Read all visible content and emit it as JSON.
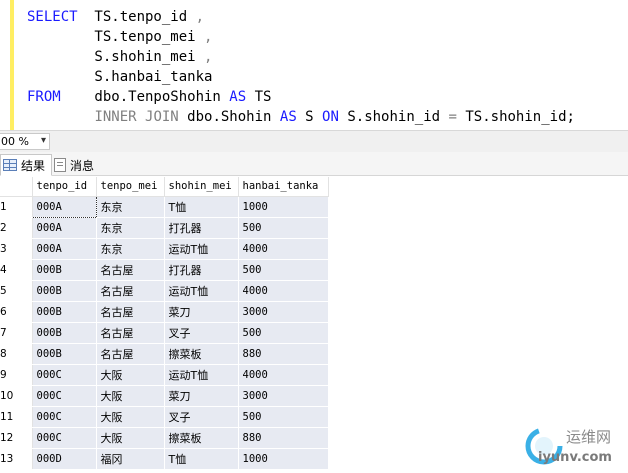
{
  "sql": {
    "lines": [
      [
        {
          "t": "SELECT",
          "c": "kw"
        },
        {
          "t": "  TS.tenpo_id ",
          "c": ""
        },
        {
          "t": ",",
          "c": "op"
        }
      ],
      [
        {
          "t": "        TS.tenpo_mei ",
          "c": ""
        },
        {
          "t": ",",
          "c": "op"
        }
      ],
      [
        {
          "t": "        S.shohin_mei ",
          "c": ""
        },
        {
          "t": ",",
          "c": "op"
        }
      ],
      [
        {
          "t": "        S.hanbai_tanka",
          "c": ""
        }
      ],
      [
        {
          "t": "FROM",
          "c": "kw"
        },
        {
          "t": "    dbo.TenpoShohin ",
          "c": ""
        },
        {
          "t": "AS",
          "c": "kw"
        },
        {
          "t": " TS",
          "c": ""
        }
      ],
      [
        {
          "t": "        ",
          "c": ""
        },
        {
          "t": "INNER JOIN",
          "c": "op"
        },
        {
          "t": " dbo.Shohin ",
          "c": ""
        },
        {
          "t": "AS",
          "c": "kw"
        },
        {
          "t": " S ",
          "c": ""
        },
        {
          "t": "ON",
          "c": "kw"
        },
        {
          "t": " S.shohin_id ",
          "c": ""
        },
        {
          "t": "=",
          "c": "op"
        },
        {
          "t": " TS.shohin_id;",
          "c": ""
        }
      ]
    ]
  },
  "zoom": {
    "value": "00 %"
  },
  "tabs": {
    "results": "结果",
    "messages": "消息"
  },
  "grid": {
    "columns": [
      "tenpo_id",
      "tenpo_mei",
      "shohin_mei",
      "hanbai_tanka"
    ],
    "rows": [
      {
        "n": "1",
        "tenpo_id": "000A",
        "tenpo_mei": "东京",
        "shohin_mei": "T恤",
        "hanbai_tanka": "1000"
      },
      {
        "n": "2",
        "tenpo_id": "000A",
        "tenpo_mei": "东京",
        "shohin_mei": "打孔器",
        "hanbai_tanka": "500"
      },
      {
        "n": "3",
        "tenpo_id": "000A",
        "tenpo_mei": "东京",
        "shohin_mei": "运动T恤",
        "hanbai_tanka": "4000"
      },
      {
        "n": "4",
        "tenpo_id": "000B",
        "tenpo_mei": "名古屋",
        "shohin_mei": "打孔器",
        "hanbai_tanka": "500"
      },
      {
        "n": "5",
        "tenpo_id": "000B",
        "tenpo_mei": "名古屋",
        "shohin_mei": "运动T恤",
        "hanbai_tanka": "4000"
      },
      {
        "n": "6",
        "tenpo_id": "000B",
        "tenpo_mei": "名古屋",
        "shohin_mei": "菜刀",
        "hanbai_tanka": "3000"
      },
      {
        "n": "7",
        "tenpo_id": "000B",
        "tenpo_mei": "名古屋",
        "shohin_mei": "叉子",
        "hanbai_tanka": "500"
      },
      {
        "n": "8",
        "tenpo_id": "000B",
        "tenpo_mei": "名古屋",
        "shohin_mei": "擦菜板",
        "hanbai_tanka": "880"
      },
      {
        "n": "9",
        "tenpo_id": "000C",
        "tenpo_mei": "大阪",
        "shohin_mei": "运动T恤",
        "hanbai_tanka": "4000"
      },
      {
        "n": "10",
        "tenpo_id": "000C",
        "tenpo_mei": "大阪",
        "shohin_mei": "菜刀",
        "hanbai_tanka": "3000"
      },
      {
        "n": "11",
        "tenpo_id": "000C",
        "tenpo_mei": "大阪",
        "shohin_mei": "叉子",
        "hanbai_tanka": "500"
      },
      {
        "n": "12",
        "tenpo_id": "000C",
        "tenpo_mei": "大阪",
        "shohin_mei": "擦菜板",
        "hanbai_tanka": "880"
      },
      {
        "n": "13",
        "tenpo_id": "000D",
        "tenpo_mei": "福冈",
        "shohin_mei": "T恤",
        "hanbai_tanka": "1000"
      }
    ]
  },
  "watermark": {
    "name": "运维网",
    "url": "iyunv.com"
  },
  "colors": {
    "keyword": "#1a1aff",
    "operator": "#808080",
    "cell_bg": "#e7eaf2",
    "margin_bar": "#ffee62"
  }
}
